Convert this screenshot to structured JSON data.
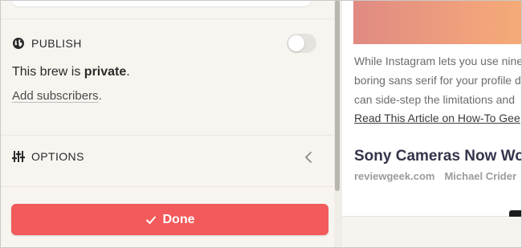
{
  "publish": {
    "heading": "PUBLISH",
    "icon": "globe-icon",
    "toggle_on": false,
    "status_prefix": "This brew is ",
    "status_value": "private",
    "status_suffix": ".",
    "subscribers_link": "Add subscribers",
    "subscribers_suffix": "."
  },
  "options": {
    "heading": "OPTIONS",
    "icon": "sliders-icon",
    "chevron": "chevron-left-icon"
  },
  "done_button": {
    "label": "Done",
    "icon": "check-icon",
    "color": "#f25a5b"
  },
  "preview": {
    "body_lines": [
      "While Instagram lets you use nine",
      "boring sans serif for your profile d",
      "can side-step the limitations and"
    ],
    "read_link": "Read This Article on How-To Gee",
    "headline": "Sony Cameras Now Work",
    "source": "reviewgeek.com",
    "author": "Michael Crider"
  }
}
